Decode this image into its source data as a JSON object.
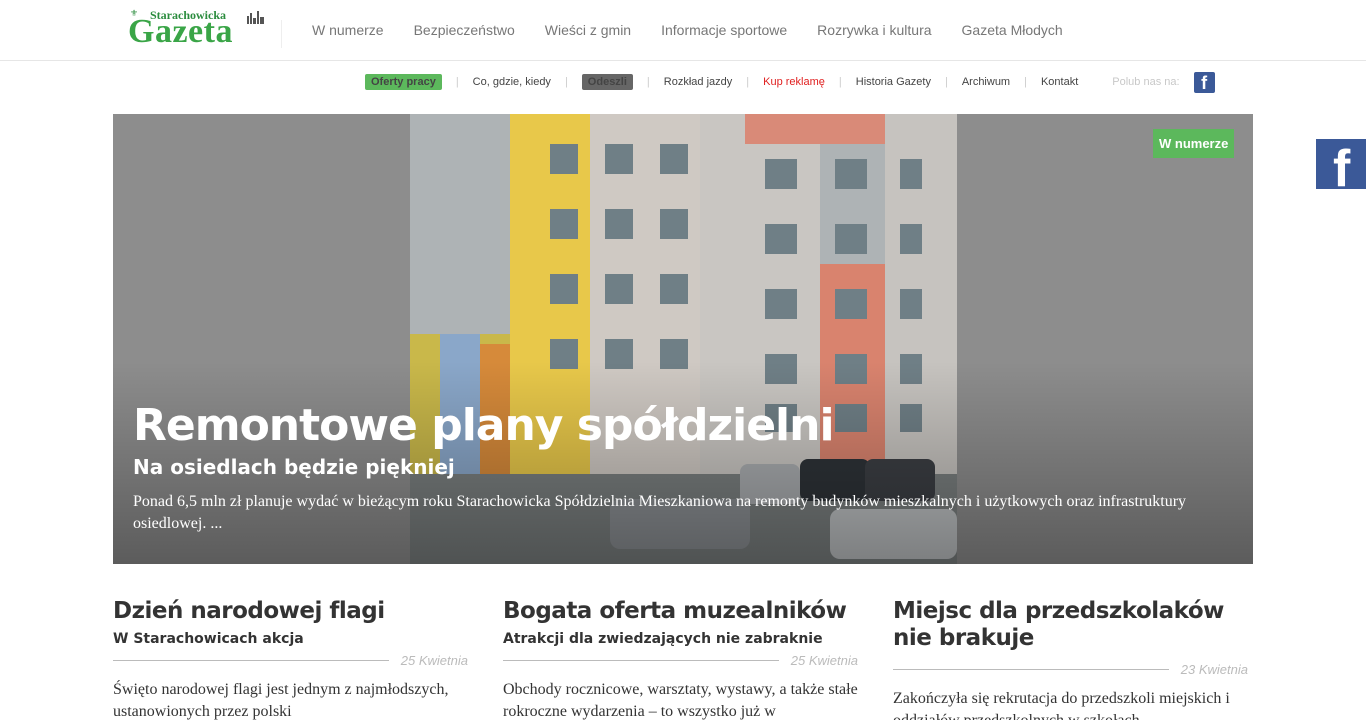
{
  "logo": {
    "small": "Starachowicka",
    "big": "Gazeta"
  },
  "main_nav": [
    "W numerze",
    "Bezpieczeństwo",
    "Wieści z gmin",
    "Informacje sportowe",
    "Rozrywka i kultura",
    "Gazeta Młodych"
  ],
  "sub_nav": {
    "oferty": "Oferty pracy",
    "co_gdzie": "Co, gdzie, kiedy",
    "odeszli": "Odeszli",
    "rozklad": "Rozkład jazdy",
    "kup": "Kup reklamę",
    "historia": "Historia Gazety",
    "archiwum": "Archiwum",
    "kontakt": "Kontakt",
    "like": "Polub nas na:",
    "fb_glyph": "f"
  },
  "hero": {
    "badge": "W numerze",
    "title": "Remontowe plany spółdzielni",
    "subtitle": "Na osiedlach będzie piękniej",
    "text": "  Ponad 6,5 mln zł planuje wydać w bieżącym roku Starachowicka Spółdzielnia Mieszkaniowa na remonty budynków mieszkalnych i użytkowych oraz infrastruktury osiedlowej. ..."
  },
  "fb_side_glyph": "f",
  "articles": [
    {
      "title": "Dzień narodowej flagi",
      "subtitle": "W Starachowicach akcja",
      "date": "25 Kwietnia",
      "text": "Święto narodowej flagi jest jednym z najmłodszych, ustanowionych przez polski"
    },
    {
      "title": "Bogata oferta muzealników",
      "subtitle": "Atrakcji dla zwiedzających nie zabraknie",
      "date": "25 Kwietnia",
      "text": "Obchody rocznicowe, warsztaty, wystawy, a także stałe rokroczne wydarzenia – to wszystko już w"
    },
    {
      "title": "Miejsc dla przedszkolaków nie brakuje",
      "subtitle": "",
      "date": "23 Kwietnia",
      "text": "Zakończyła się rekrutacja do przedszkoli miejskich i oddziałów przedszkolnych w szkołach"
    }
  ]
}
